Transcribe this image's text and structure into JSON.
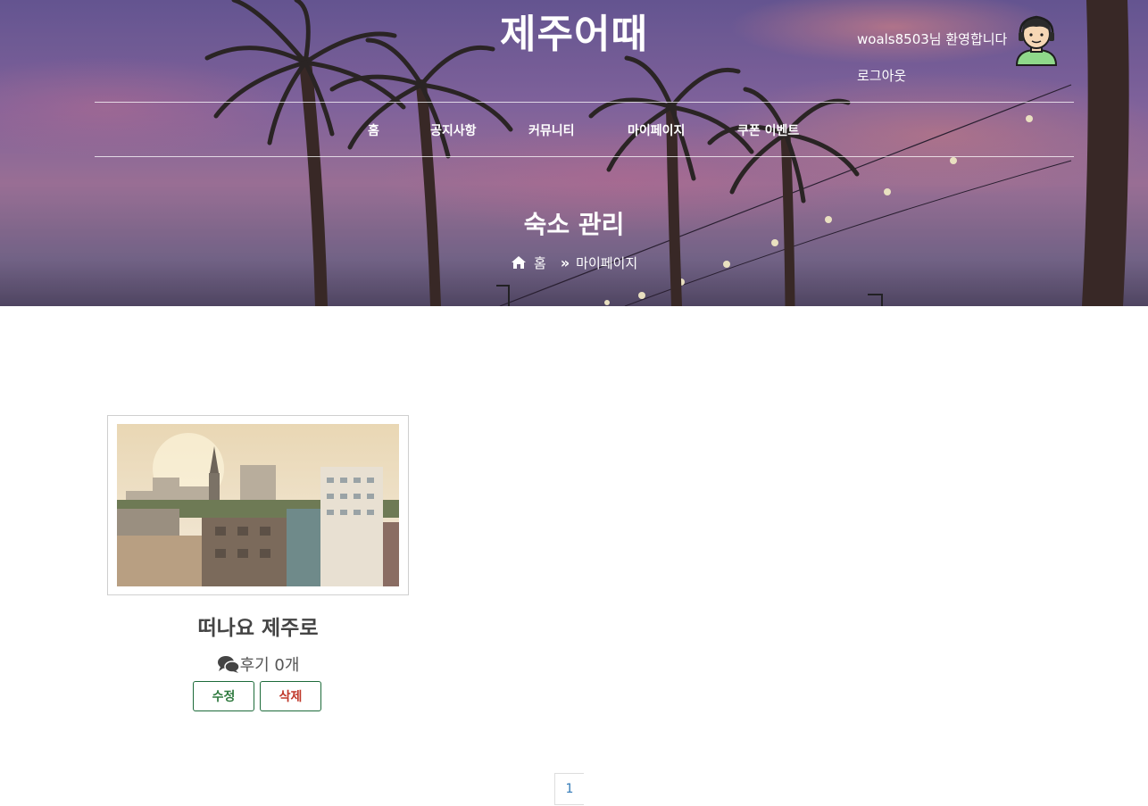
{
  "header": {
    "logo": "제주어때",
    "welcome": "woals8503님 환영합니다",
    "logout": "로그아웃"
  },
  "nav": {
    "items": [
      {
        "label": "홈"
      },
      {
        "label": "공지사항"
      },
      {
        "label": "커뮤니티"
      },
      {
        "label": "마이페이지"
      },
      {
        "label": "쿠폰 이벤트"
      }
    ]
  },
  "hero": {
    "title": "숙소 관리",
    "breadcrumb": {
      "home": "홈",
      "current": "마이페이지"
    }
  },
  "listing": {
    "title": "떠나요 제주로",
    "review_text": "후기 0개",
    "edit_label": "수정",
    "delete_label": "삭제"
  },
  "pagination": {
    "pages": [
      "1"
    ],
    "current": "1"
  },
  "colors": {
    "accent_green": "#2f7a3f",
    "danger_red": "#c0392b",
    "link_blue": "#337ab7"
  },
  "icons": {
    "avatar": "user-avatar-icon",
    "home": "home-icon",
    "separator": "double-chevron-right-icon",
    "review": "chat-bubbles-icon"
  }
}
